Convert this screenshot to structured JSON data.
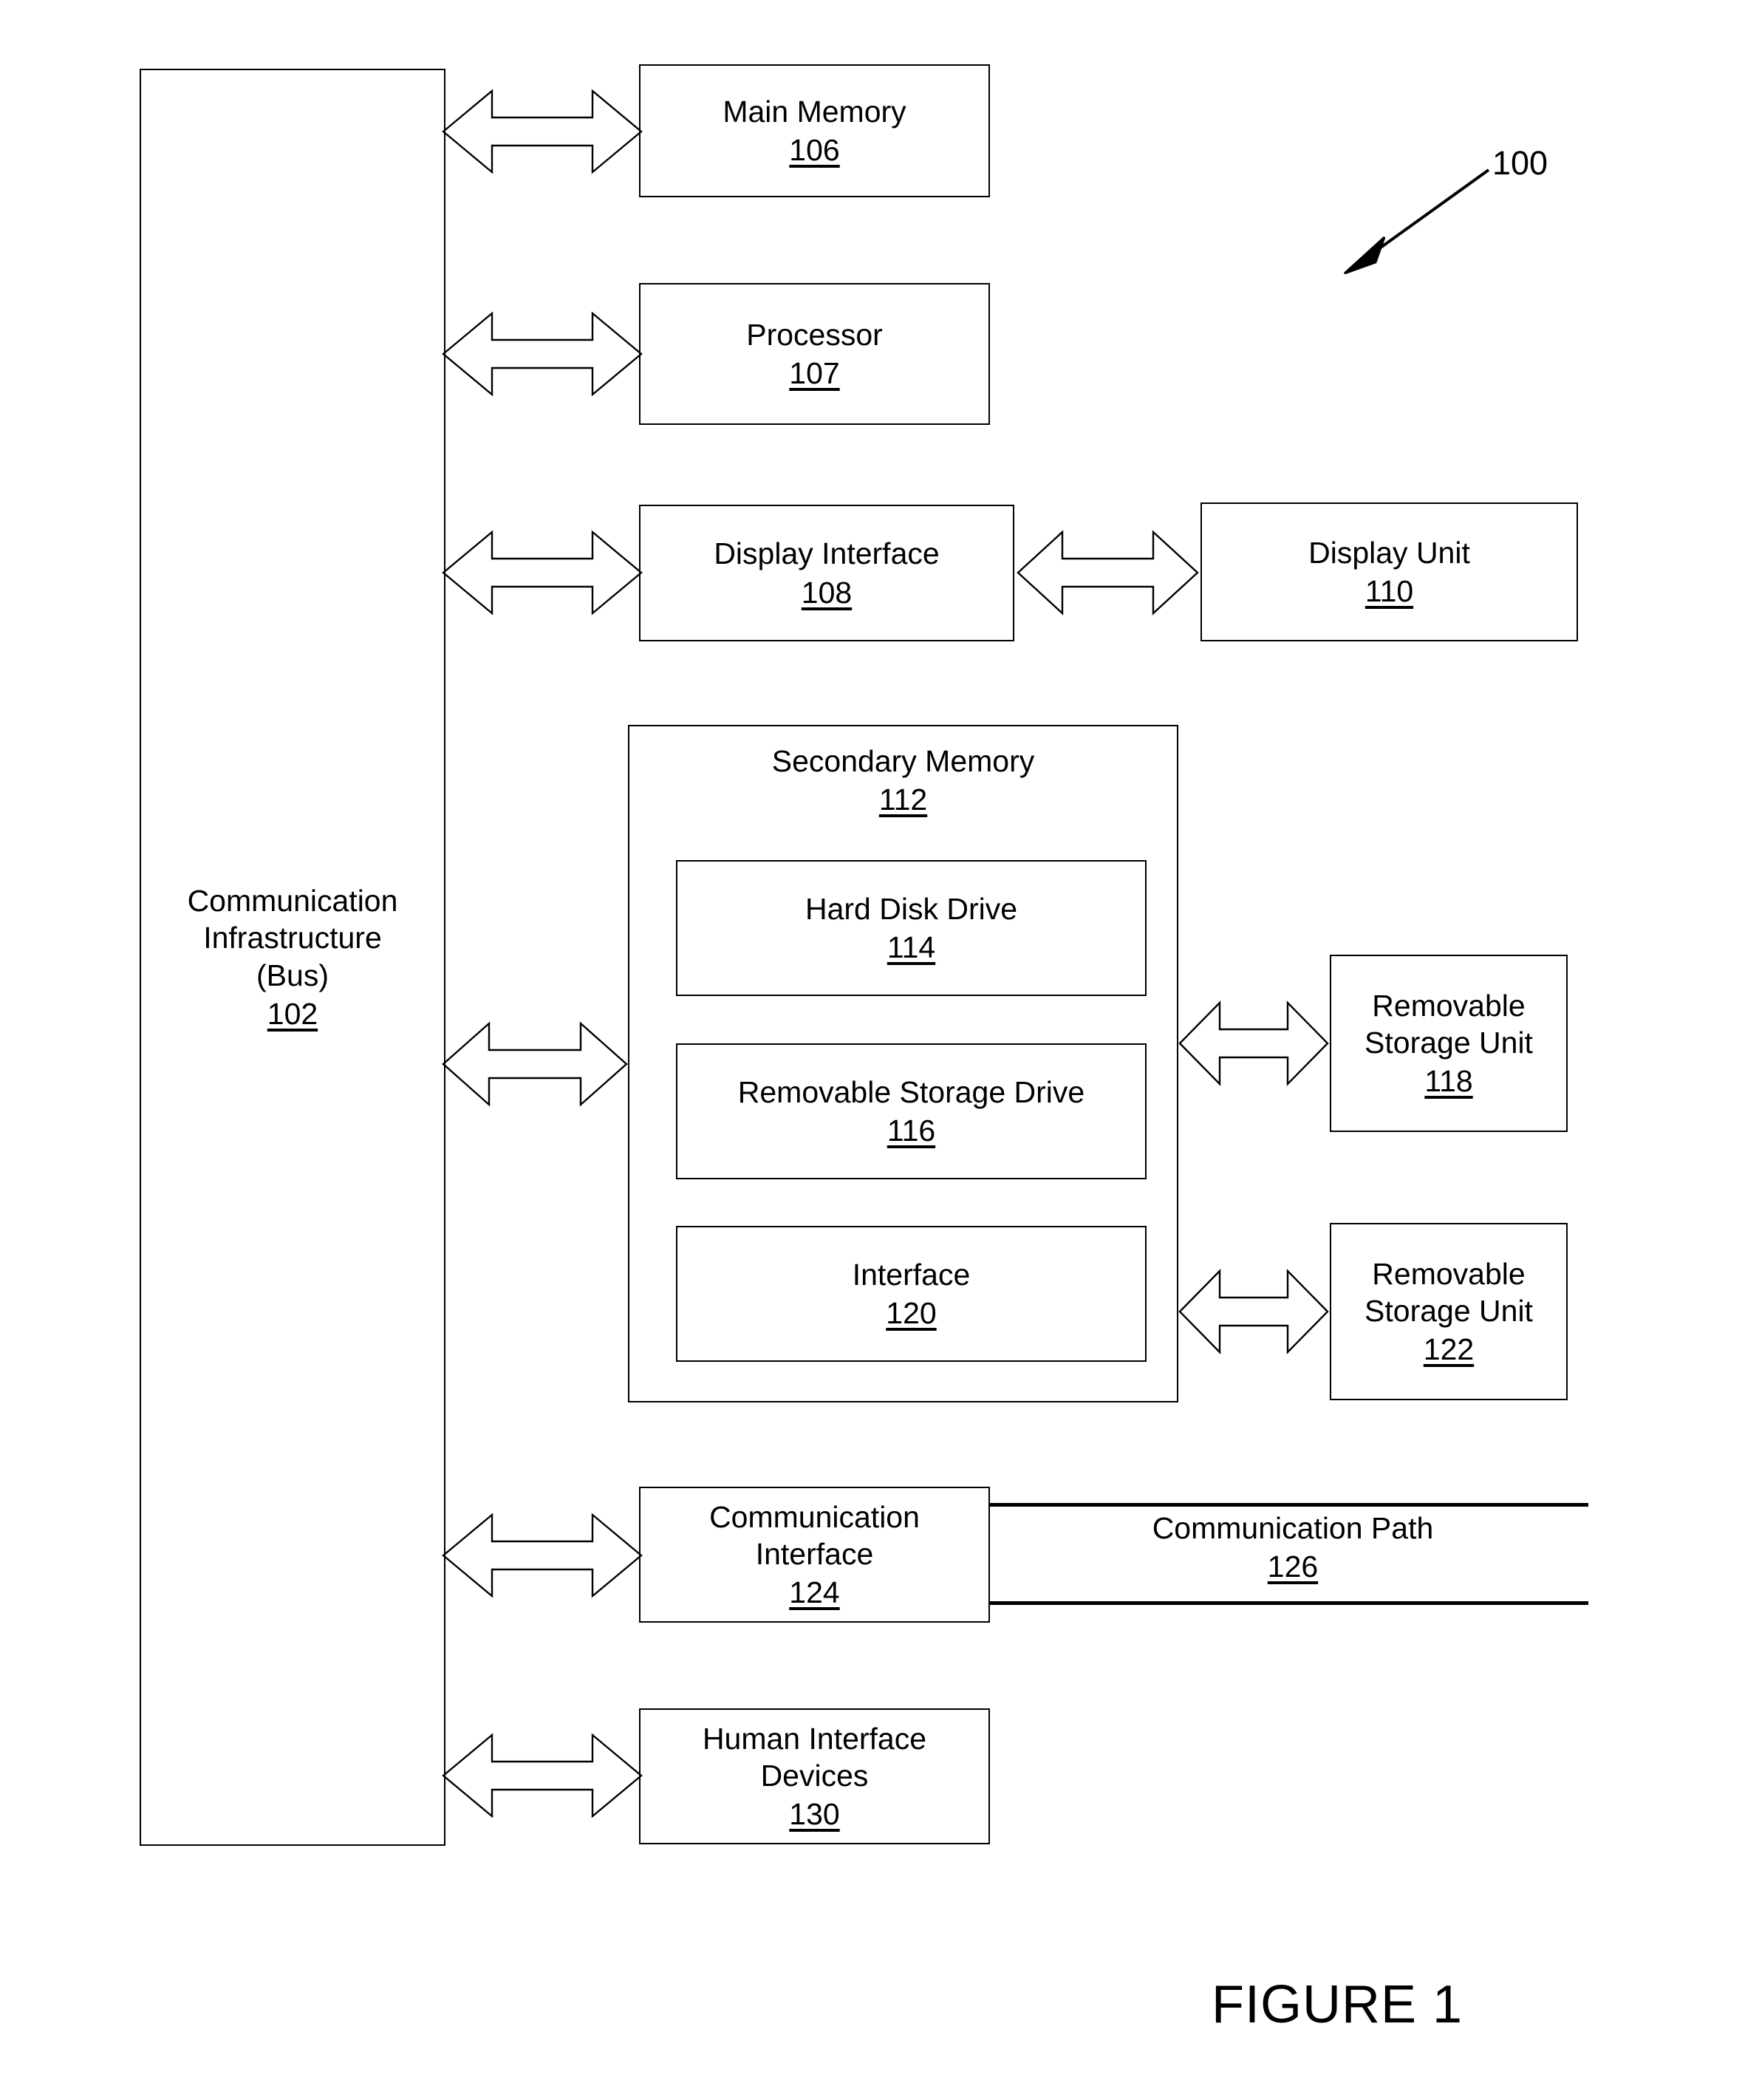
{
  "figure": {
    "caption": "FIGURE 1",
    "system_reference": "100"
  },
  "blocks": {
    "bus": {
      "label": "Communication\nInfrastructure\n(Bus)",
      "number": "102"
    },
    "main_memory": {
      "label": "Main Memory",
      "number": "106"
    },
    "processor": {
      "label": "Processor",
      "number": "107"
    },
    "display_interface": {
      "label": "Display Interface",
      "number": "108"
    },
    "display_unit": {
      "label": "Display Unit",
      "number": "110"
    },
    "secondary_memory": {
      "label": "Secondary Memory",
      "number": "112"
    },
    "hard_disk_drive": {
      "label": "Hard Disk Drive",
      "number": "114"
    },
    "removable_storage_drive": {
      "label": "Removable Storage Drive",
      "number": "116"
    },
    "removable_storage_unit_118": {
      "label": "Removable\nStorage Unit",
      "number": "118"
    },
    "interface": {
      "label": "Interface",
      "number": "120"
    },
    "removable_storage_unit_122": {
      "label": "Removable\nStorage Unit",
      "number": "122"
    },
    "communication_interface": {
      "label": "Communication\nInterface",
      "number": "124"
    },
    "communication_path": {
      "label": "Communication Path",
      "number": "126"
    },
    "human_interface_devices": {
      "label": "Human Interface\nDevices",
      "number": "130"
    }
  },
  "connectors": [
    {
      "name": "bus-to-main-memory",
      "type": "double-headed-arrow"
    },
    {
      "name": "bus-to-processor",
      "type": "double-headed-arrow"
    },
    {
      "name": "bus-to-display-interface",
      "type": "double-headed-arrow"
    },
    {
      "name": "display-interface-to-display-unit",
      "type": "double-headed-arrow"
    },
    {
      "name": "bus-to-secondary-memory",
      "type": "double-headed-arrow"
    },
    {
      "name": "removable-storage-drive-to-unit-118",
      "type": "double-headed-arrow"
    },
    {
      "name": "interface-to-unit-122",
      "type": "double-headed-arrow"
    },
    {
      "name": "bus-to-communication-interface",
      "type": "double-headed-arrow"
    },
    {
      "name": "bus-to-human-interface-devices",
      "type": "double-headed-arrow"
    },
    {
      "name": "system-100-leader",
      "type": "solid-arrow"
    }
  ],
  "colors": {
    "stroke": "#000000",
    "background": "#ffffff"
  }
}
